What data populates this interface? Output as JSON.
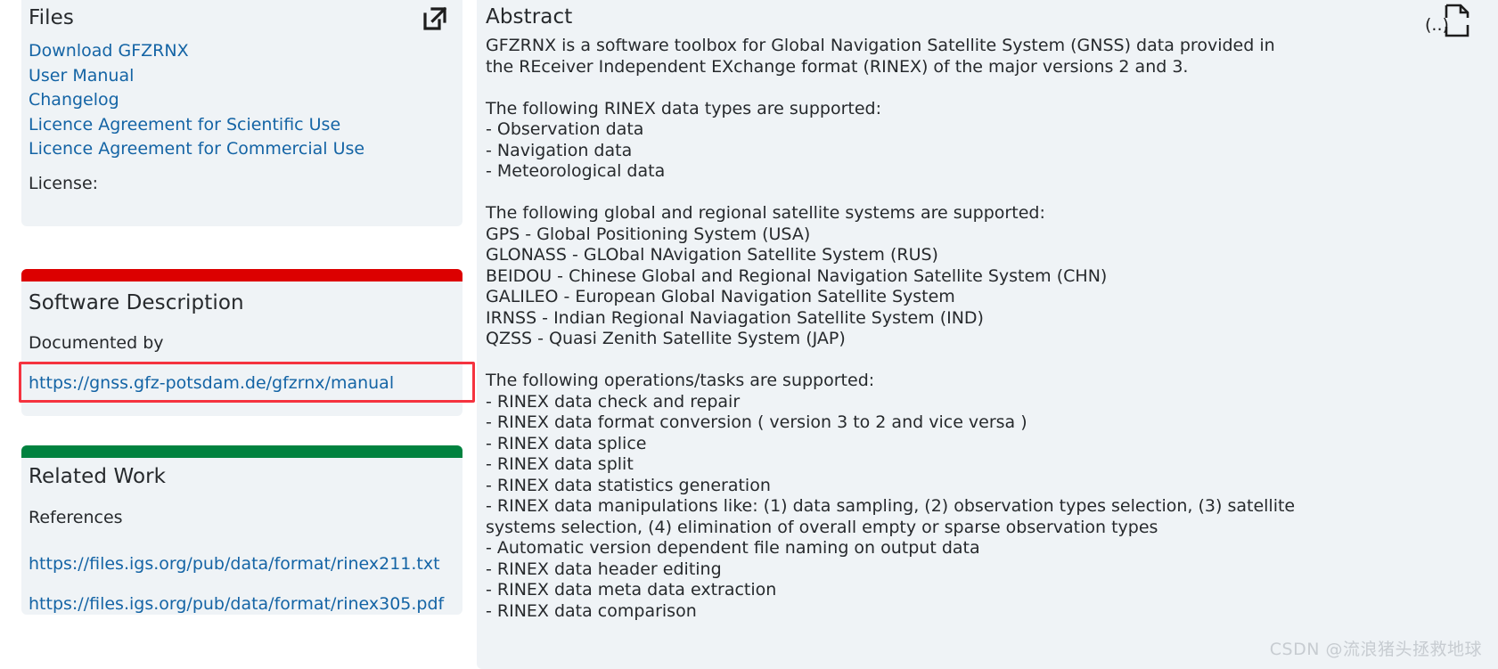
{
  "colors": {
    "panel_bg": "#eff3f6",
    "link": "#1464a5",
    "text": "#26292c",
    "accent_red": "#dc0000",
    "accent_green": "#00823f",
    "annotation_red": "#f5333f",
    "watermark": "#c7ccd1"
  },
  "files_panel": {
    "title": "Files",
    "external_link_icon": "external-link-icon",
    "links": [
      "Download GFZRNX",
      "User Manual",
      "Changelog",
      "Licence Agreement for Scientific Use",
      "Licence Agreement for Commercial Use"
    ],
    "license_label": "License:"
  },
  "software_panel": {
    "title": "Software Description",
    "documented_by_label": "Documented by",
    "manual_url": "https://gnss.gfz-potsdam.de/gfzrnx/manual"
  },
  "related_panel": {
    "title": "Related Work",
    "references_label": "References",
    "references": [
      "https://files.igs.org/pub/data/format/rinex211.txt",
      "https://files.igs.org/pub/data/format/rinex305.pdf"
    ]
  },
  "abstract_panel": {
    "title": "Abstract",
    "doc_icon": "abstract-document-icon",
    "body": "GFZRNX is a software toolbox for Global Navigation Satellite System (GNSS) data provided in\nthe REceiver Independent EXchange format (RINEX) of the major versions 2 and 3.\n\nThe following RINEX data types are supported:\n- Observation data\n- Navigation data\n- Meteorological data\n\nThe following global and regional satellite systems are supported:\nGPS - Global Positioning System (USA)\nGLONASS - GLObal NAvigation Satellite System (RUS)\nBEIDOU - Chinese Global and Regional Navigation Satellite System (CHN)\nGALILEO - European Global Navigation Satellite System\nIRNSS - Indian Regional Naviagation Satellite System (IND)\nQZSS - Quasi Zenith Satellite System (JAP)\n\nThe following operations/tasks are supported:\n- RINEX data check and repair\n- RINEX data format conversion ( version 3 to 2 and vice versa )\n- RINEX data splice\n- RINEX data split\n- RINEX data statistics generation\n- RINEX data manipulations like: (1) data sampling, (2) observation types selection, (3) satellite\nsystems selection, (4) elimination of overall empty or sparse observation types\n- Automatic version dependent file naming on output data\n- RINEX data header editing\n- RINEX data meta data extraction\n- RINEX data comparison"
  },
  "watermark": {
    "text": "CSDN @流浪猪头拯救地球"
  }
}
